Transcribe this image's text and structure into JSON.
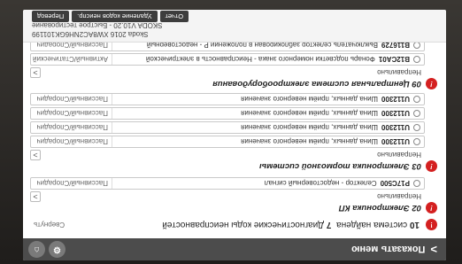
{
  "header": {
    "menu_label": "Показать меню",
    "menu_chevron": ">",
    "icons": [
      "settings-icon",
      "home-icon"
    ]
  },
  "summary": {
    "badge": "!",
    "prefix": "10",
    "text": "система найдена",
    "count": "7",
    "suffix": "Диагностические коды неисправностей",
    "link": "Свернуть"
  },
  "groups": [
    {
      "badge": "!",
      "title": "02 Электроника КП",
      "subtitle": "Неправильно",
      "expand": ">",
      "faults": [
        {
          "code": "P17C500",
          "desc": "Селектор - недостоверный сигнал",
          "status": "Пассивный/Спорадич"
        }
      ]
    },
    {
      "badge": "!",
      "title": "03 Электроника тормозной системы",
      "subtitle": "Неправильно",
      "expand": ">",
      "faults": [
        {
          "code": "U112300",
          "desc": "Шина данных, приём неверного значения",
          "status": "Пассивный/Спорадич"
        },
        {
          "code": "U112300",
          "desc": "Шина данных, приём неверного значения",
          "status": "Пассивный/Спорадич"
        },
        {
          "code": "U112300",
          "desc": "Шина данных, приём неверного значения",
          "status": "Пассивный/Спорадич"
        },
        {
          "code": "U112300",
          "desc": "Шина данных, приём неверного значения",
          "status": "Пассивный/Спорадич"
        }
      ]
    },
    {
      "badge": "!",
      "title": "09 Центральная система электрооборудования",
      "subtitle": "Неправильно",
      "expand": ">",
      "faults": [
        {
          "code": "B12CA01",
          "desc": "Фонарь подсветки номерного знака - Неисправность в электрической",
          "status": "Активный/Статический"
        },
        {
          "code": "B116729",
          "desc": "Выключатель селектор заблокирован в положении P - недостоверный",
          "status": "Пассивный/Спорадич"
        }
      ]
    }
  ],
  "footer": {
    "vin_line": "Skoda 2016 XW8AC2NH6GK101199",
    "version_line": "SKODA V10.20 - Быстрое тестирование",
    "buttons": [
      "Отчет",
      "Удаление кодов неиспр.",
      "Перевод"
    ]
  }
}
